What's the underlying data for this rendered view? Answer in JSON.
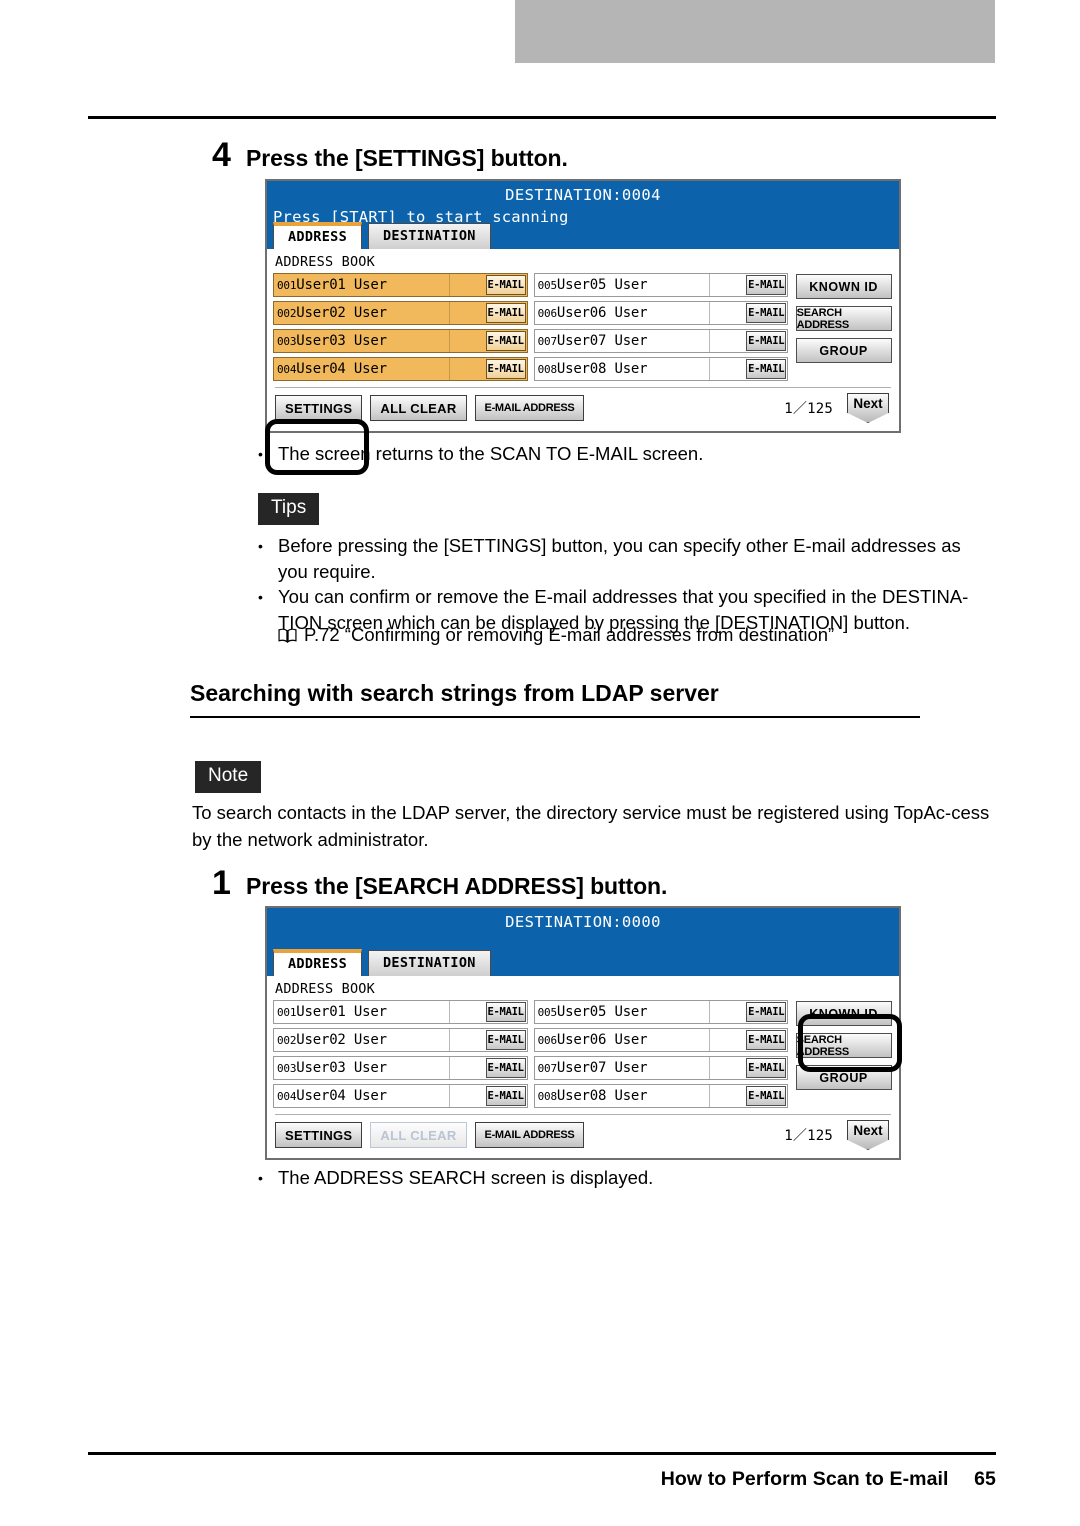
{
  "footer": {
    "title": "How to Perform Scan to E-mail",
    "page": "65"
  },
  "steps": [
    {
      "number": "4",
      "text": "Press the [SETTINGS] button."
    },
    {
      "number": "1",
      "text": "Press the [SEARCH ADDRESS] button."
    }
  ],
  "result_note_1": "The screen returns to the SCAN TO E-MAIL screen.",
  "result_note_2": "The ADDRESS SEARCH screen is displayed.",
  "tips": {
    "label": "Tips",
    "items": [
      "Before pressing the [SETTINGS] button, you can specify other E-mail addresses as you require.",
      "You can confirm or remove the E-mail addresses that you specified in the DESTINA-TION screen which can be displayed by pressing the [DESTINATION] button."
    ],
    "reference": "P.72 “Confirming or removing E-mail addresses from destination”"
  },
  "section_heading": "Searching with search strings from LDAP server",
  "note": {
    "label": "Note",
    "text": "To search contacts in the LDAP server, the directory service must be registered using TopAc-cess by the network administrator."
  },
  "bullet_char": "•",
  "colors": {
    "lcd_header": "#0d63ab",
    "tab_accent": "#e8a33d",
    "selected_row": "#f2b95c",
    "chip_bg": "#262626",
    "page_header_bar": "#b5b5b5"
  },
  "panels": [
    {
      "id": "panel-1",
      "title": "DESTINATION:0004",
      "subtitle": "Press [START] to start scanning",
      "tabs": [
        {
          "label": "ADDRESS",
          "active": true
        },
        {
          "label": "DESTINATION",
          "active": false
        }
      ],
      "address_book_label": "ADDRESS BOOK",
      "email_button_label": "E-MAIL",
      "left_entries": [
        {
          "index": "001",
          "name": "User01 User",
          "selected": true
        },
        {
          "index": "002",
          "name": "User02 User",
          "selected": true
        },
        {
          "index": "003",
          "name": "User03 User",
          "selected": true
        },
        {
          "index": "004",
          "name": "User04 User",
          "selected": true
        }
      ],
      "right_entries": [
        {
          "index": "005",
          "name": "User05 User",
          "selected": false
        },
        {
          "index": "006",
          "name": "User06 User",
          "selected": false
        },
        {
          "index": "007",
          "name": "User07 User",
          "selected": false
        },
        {
          "index": "008",
          "name": "User08 User",
          "selected": false
        }
      ],
      "side_buttons": [
        {
          "label": "KNOWN ID",
          "style": "bold"
        },
        {
          "label": "SEARCH ADDRESS",
          "style": "small"
        },
        {
          "label": "GROUP",
          "style": "bold"
        }
      ],
      "bottom_buttons": [
        {
          "label": "SETTINGS",
          "disabled": false,
          "tight": false
        },
        {
          "label": "ALL CLEAR",
          "disabled": false,
          "tight": false
        },
        {
          "label": "E-MAIL ADDRESS",
          "disabled": false,
          "tight": true
        }
      ],
      "page_indicator": "1／125",
      "next_label": "Next",
      "callout_target": "settings-button"
    },
    {
      "id": "panel-2",
      "title": "DESTINATION:0000",
      "subtitle": "",
      "tabs": [
        {
          "label": "ADDRESS",
          "active": true
        },
        {
          "label": "DESTINATION",
          "active": false
        }
      ],
      "address_book_label": "ADDRESS BOOK",
      "email_button_label": "E-MAIL",
      "left_entries": [
        {
          "index": "001",
          "name": "User01 User",
          "selected": false
        },
        {
          "index": "002",
          "name": "User02 User",
          "selected": false
        },
        {
          "index": "003",
          "name": "User03 User",
          "selected": false
        },
        {
          "index": "004",
          "name": "User04 User",
          "selected": false
        }
      ],
      "right_entries": [
        {
          "index": "005",
          "name": "User05 User",
          "selected": false
        },
        {
          "index": "006",
          "name": "User06 User",
          "selected": false
        },
        {
          "index": "007",
          "name": "User07 User",
          "selected": false
        },
        {
          "index": "008",
          "name": "User08 User",
          "selected": false
        }
      ],
      "side_buttons": [
        {
          "label": "KNOWN ID",
          "style": "bold"
        },
        {
          "label": "SEARCH ADDRESS",
          "style": "small"
        },
        {
          "label": "GROUP",
          "style": "bold"
        }
      ],
      "bottom_buttons": [
        {
          "label": "SETTINGS",
          "disabled": false,
          "tight": false
        },
        {
          "label": "ALL CLEAR",
          "disabled": true,
          "tight": false
        },
        {
          "label": "E-MAIL ADDRESS",
          "disabled": false,
          "tight": true
        }
      ],
      "page_indicator": "1／125",
      "next_label": "Next",
      "callout_target": "search-address-button"
    }
  ]
}
